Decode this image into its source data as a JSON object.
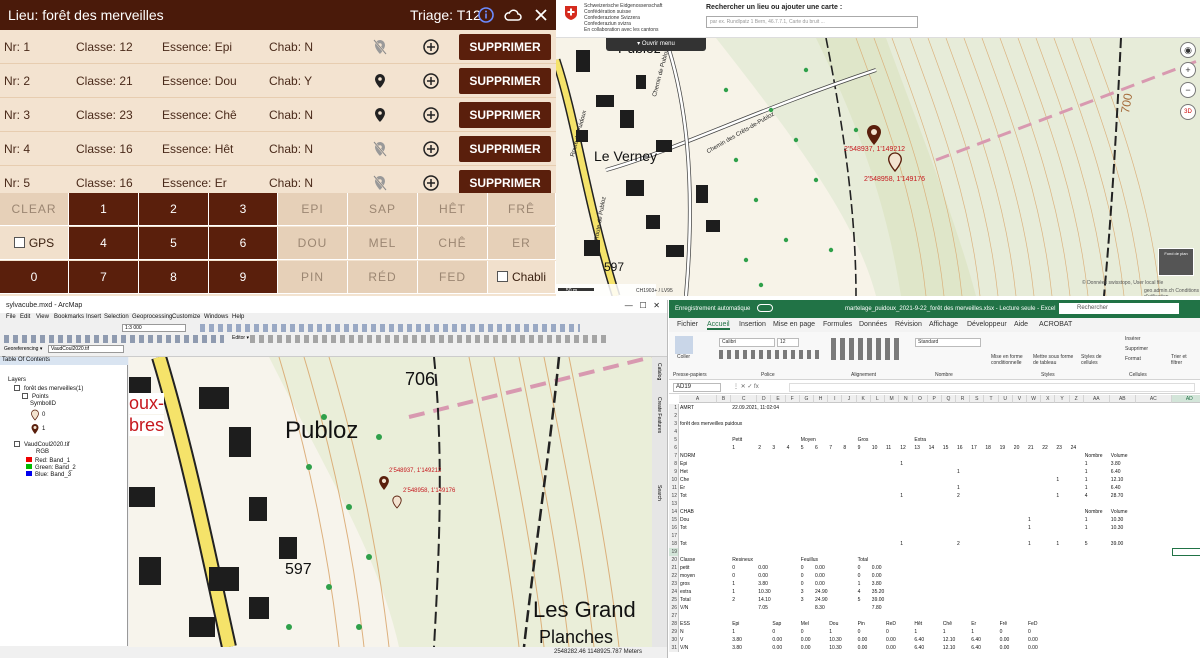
{
  "app": {
    "header": {
      "title": "Lieu: forêt des merveilles",
      "triage": "Triage: T12"
    },
    "rows": [
      {
        "nr": "Nr: 1",
        "classe": "Classe: 12",
        "essence": "Essence: Epi",
        "chab": "Chab: N",
        "pin": "off"
      },
      {
        "nr": "Nr: 2",
        "classe": "Classe: 21",
        "essence": "Essence: Dou",
        "chab": "Chab: Y",
        "pin": "on"
      },
      {
        "nr": "Nr: 3",
        "classe": "Classe: 23",
        "essence": "Essence: Chê",
        "chab": "Chab: N",
        "pin": "on"
      },
      {
        "nr": "Nr: 4",
        "classe": "Classe: 16",
        "essence": "Essence: Hêt",
        "chab": "Chab: N",
        "pin": "off"
      },
      {
        "nr": "Nr: 5",
        "classe": "Classe: 16",
        "essence": "Essence: Er",
        "chab": "Chab: N",
        "pin": "off"
      }
    ],
    "delete_label": "SUPPRIMER",
    "keypad": {
      "clear": "CLEAR",
      "gps": "GPS",
      "zero": "0",
      "chabli": "Chabli",
      "digits": [
        "1",
        "2",
        "3",
        "4",
        "5",
        "6",
        "7",
        "8",
        "9"
      ],
      "species": [
        "EPI",
        "SAP",
        "HÊT",
        "FRÊ",
        "DOU",
        "MEL",
        "CHÊ",
        "ER",
        "PIN",
        "RÉD",
        "FED"
      ]
    }
  },
  "swiss_map": {
    "confed": [
      "Schweizerische Eidgenossenschaft",
      "Confédération suisse",
      "Confederazione Svizzera",
      "Confederaziun svizra",
      "En collaboration avec les cantons"
    ],
    "search_label": "Rechercher un lieu ou ajouter une carte :",
    "search_placeholder": "par ex. Rundlpatz 1 Bern, 46.7.7.1, Carte du bruit ...",
    "open_menu": "Ouvrir menu",
    "place_names": [
      "Le Verney",
      "Publoz",
      "Chemin de Publoz",
      "Chemin des Crêts-de-Publoz",
      "Route de Puidoux",
      "Route de Publoz"
    ],
    "contour": "700",
    "spot_height": "597",
    "marker_labels": [
      "2'548937, 1'149212",
      "2'548958, 1'149176"
    ],
    "scale": "50 m",
    "coord_system": "CH1903+ / LV95",
    "copyright": "© Données swisstopo, User local file",
    "footer": "geo.admin.ch   Conditions d'utilisation",
    "basemap": "Fond de plan"
  },
  "arcmap": {
    "title": "sylvacube.mxd - ArcMap",
    "menu": [
      "File",
      "Edit",
      "View",
      "Bookmarks",
      "Insert",
      "Selection",
      "Geoprocessing",
      "Customize",
      "Windows",
      "Help"
    ],
    "scale": "1:3 000",
    "georef_label": "Georeferencing ▾",
    "georef_layer": "VaudCoul2020.tif",
    "editor": "Editor ▾",
    "toc_title": "Table Of Contents",
    "toc": [
      "Layers",
      "forêt des merveilles(1)",
      "Points",
      "SymbolID",
      "0",
      "1",
      "VaudCoul2020.tif",
      "RGB",
      "Red: Band_1",
      "Green: Band_2",
      "Blue: Band_3"
    ],
    "map_labels": [
      "Publoz",
      "706",
      "597",
      "oux-",
      "bres",
      "Les Grand",
      "Planches"
    ],
    "marker_labels": [
      "2'548937, 1'149212",
      "2'548958, 1'149176"
    ],
    "side_tabs": [
      "Catalog",
      "Create Features",
      "Search"
    ],
    "status": "2548282.46  1148925.787 Meters"
  },
  "excel": {
    "autosave": "Enregistrement automatique",
    "filename": "martelage_puidoux_2021-9-22_forêt des merveilles.xlsx - Lecture seule - Excel",
    "search": "Rechercher",
    "tabs": [
      "Fichier",
      "Accueil",
      "Insertion",
      "Mise en page",
      "Formules",
      "Données",
      "Révision",
      "Affichage",
      "Développeur",
      "Aide",
      "ACROBAT"
    ],
    "ribbon": {
      "paste": "Coller",
      "font": "Calibri",
      "size": "12",
      "format": "Standard",
      "clipboard": "Presse-papiers",
      "police": "Police",
      "alignement": "Alignement",
      "nombre": "Nombre",
      "styles": "Styles",
      "cellules": "Cellules",
      "mef_cond": "Mise en forme conditionnelle",
      "mef_table": "Mettre sous forme de tableau",
      "styles_cell": "Styles de cellules",
      "insert": "Insérer",
      "delete": "Supprimer",
      "format_btn": "Format",
      "sort": "Trier et filtrer"
    },
    "name_box": "AD19",
    "columns": [
      "A",
      "B",
      "C",
      "D",
      "E",
      "F",
      "G",
      "H",
      "I",
      "J",
      "K",
      "L",
      "M",
      "N",
      "O",
      "P",
      "Q",
      "R",
      "S",
      "T",
      "U",
      "V",
      "W",
      "X",
      "Y",
      "Z",
      "AA",
      "AB",
      "AC",
      "AD"
    ],
    "rows": [
      {
        "n": "1",
        "cells": [
          [
            "A",
            "AMRT"
          ],
          [
            "C",
            "22.09.2021, 11:02:04"
          ]
        ]
      },
      {
        "n": "2",
        "cells": []
      },
      {
        "n": "3",
        "cells": [
          [
            "A",
            "forêt des merveilles puidoux"
          ]
        ]
      },
      {
        "n": "4",
        "cells": []
      },
      {
        "n": "5",
        "cells": [
          [
            "C",
            "Petit"
          ],
          [
            "G",
            "Moyen"
          ],
          [
            "K",
            "Gros"
          ],
          [
            "O",
            "Extra"
          ]
        ]
      },
      {
        "n": "6",
        "cells": [
          [
            "C",
            "1"
          ],
          [
            "D",
            "2"
          ],
          [
            "E",
            "3"
          ],
          [
            "F",
            "4"
          ],
          [
            "G",
            "5"
          ],
          [
            "H",
            "6"
          ],
          [
            "I",
            "7"
          ],
          [
            "J",
            "8"
          ],
          [
            "K",
            "9"
          ],
          [
            "L",
            "10"
          ],
          [
            "M",
            "11"
          ],
          [
            "N",
            "12"
          ],
          [
            "O",
            "13"
          ],
          [
            "P",
            "14"
          ],
          [
            "Q",
            "15"
          ],
          [
            "R",
            "16"
          ],
          [
            "S",
            "17"
          ],
          [
            "T",
            "18"
          ],
          [
            "U",
            "19"
          ],
          [
            "V",
            "20"
          ],
          [
            "W",
            "21"
          ],
          [
            "X",
            "22"
          ],
          [
            "Y",
            "23"
          ],
          [
            "Z",
            "24"
          ]
        ]
      },
      {
        "n": "7",
        "cells": [
          [
            "A",
            "NORM"
          ],
          [
            "AA",
            "Nombre"
          ],
          [
            "AB",
            "Volume"
          ]
        ]
      },
      {
        "n": "8",
        "cells": [
          [
            "A",
            "Epi"
          ],
          [
            "N",
            "1"
          ],
          [
            "AA",
            "1"
          ],
          [
            "AB",
            "3.80"
          ]
        ]
      },
      {
        "n": "9",
        "cells": [
          [
            "A",
            "Het"
          ],
          [
            "R",
            "1"
          ],
          [
            "AA",
            "1"
          ],
          [
            "AB",
            "6.40"
          ]
        ]
      },
      {
        "n": "10",
        "cells": [
          [
            "A",
            "Che"
          ],
          [
            "Y",
            "1"
          ],
          [
            "AA",
            "1"
          ],
          [
            "AB",
            "12.10"
          ]
        ]
      },
      {
        "n": "11",
        "cells": [
          [
            "A",
            "Er"
          ],
          [
            "R",
            "1"
          ],
          [
            "AA",
            "1"
          ],
          [
            "AB",
            "6.40"
          ]
        ]
      },
      {
        "n": "12",
        "cells": [
          [
            "A",
            "Tot"
          ],
          [
            "N",
            "1"
          ],
          [
            "R",
            "2"
          ],
          [
            "Y",
            "1"
          ],
          [
            "AA",
            "4"
          ],
          [
            "AB",
            "28.70"
          ]
        ]
      },
      {
        "n": "13",
        "cells": []
      },
      {
        "n": "14",
        "cells": [
          [
            "A",
            "CHAB"
          ],
          [
            "AA",
            "Nombre"
          ],
          [
            "AB",
            "Volume"
          ]
        ]
      },
      {
        "n": "15",
        "cells": [
          [
            "A",
            "Dou"
          ],
          [
            "W",
            "1"
          ],
          [
            "AA",
            "1"
          ],
          [
            "AB",
            "10.30"
          ]
        ]
      },
      {
        "n": "16",
        "cells": [
          [
            "A",
            "Tot"
          ],
          [
            "W",
            "1"
          ],
          [
            "AA",
            "1"
          ],
          [
            "AB",
            "10.30"
          ]
        ]
      },
      {
        "n": "17",
        "cells": []
      },
      {
        "n": "18",
        "cells": [
          [
            "A",
            "Tot"
          ],
          [
            "N",
            "1"
          ],
          [
            "R",
            "2"
          ],
          [
            "W",
            "1"
          ],
          [
            "Y",
            "1"
          ],
          [
            "AA",
            "5"
          ],
          [
            "AB",
            "39.00"
          ]
        ]
      },
      {
        "n": "19",
        "cells": []
      },
      {
        "n": "20",
        "cells": [
          [
            "A",
            "Classe"
          ],
          [
            "C",
            "Resineux"
          ],
          [
            "G",
            "Feuillus"
          ],
          [
            "K",
            "Total"
          ]
        ]
      },
      {
        "n": "21",
        "cells": [
          [
            "A",
            "petit"
          ],
          [
            "C",
            "0"
          ],
          [
            "D",
            "0.00"
          ],
          [
            "G",
            "0"
          ],
          [
            "H",
            "0.00"
          ],
          [
            "K",
            "0"
          ],
          [
            "L",
            "0.00"
          ]
        ]
      },
      {
        "n": "22",
        "cells": [
          [
            "A",
            "moyen"
          ],
          [
            "C",
            "0"
          ],
          [
            "D",
            "0.00"
          ],
          [
            "G",
            "0"
          ],
          [
            "H",
            "0.00"
          ],
          [
            "K",
            "0"
          ],
          [
            "L",
            "0.00"
          ]
        ]
      },
      {
        "n": "23",
        "cells": [
          [
            "A",
            "gros"
          ],
          [
            "C",
            "1"
          ],
          [
            "D",
            "3.80"
          ],
          [
            "G",
            "0"
          ],
          [
            "H",
            "0.00"
          ],
          [
            "K",
            "1"
          ],
          [
            "L",
            "3.80"
          ]
        ]
      },
      {
        "n": "24",
        "cells": [
          [
            "A",
            "extra"
          ],
          [
            "C",
            "1"
          ],
          [
            "D",
            "10.30"
          ],
          [
            "G",
            "3"
          ],
          [
            "H",
            "24.90"
          ],
          [
            "K",
            "4"
          ],
          [
            "L",
            "35.20"
          ]
        ]
      },
      {
        "n": "25",
        "cells": [
          [
            "A",
            "Total"
          ],
          [
            "C",
            "2"
          ],
          [
            "D",
            "14.10"
          ],
          [
            "G",
            "3"
          ],
          [
            "H",
            "24.90"
          ],
          [
            "K",
            "5"
          ],
          [
            "L",
            "39.00"
          ]
        ]
      },
      {
        "n": "26",
        "cells": [
          [
            "A",
            "V/N"
          ],
          [
            "D",
            "7.05"
          ],
          [
            "H",
            "8.30"
          ],
          [
            "L",
            "7.80"
          ]
        ]
      },
      {
        "n": "27",
        "cells": []
      },
      {
        "n": "28",
        "cells": [
          [
            "A",
            "ESS"
          ],
          [
            "C",
            "Epi"
          ],
          [
            "E",
            "Sap"
          ],
          [
            "G",
            "Mel"
          ],
          [
            "I",
            "Dou"
          ],
          [
            "K",
            "Pin"
          ],
          [
            "M",
            "ReD"
          ],
          [
            "O",
            "Hêt"
          ],
          [
            "Q",
            "Chê"
          ],
          [
            "S",
            "Er"
          ],
          [
            "U",
            "Frê"
          ],
          [
            "W",
            "FeD"
          ]
        ]
      },
      {
        "n": "29",
        "cells": [
          [
            "A",
            "N"
          ],
          [
            "C",
            "1"
          ],
          [
            "E",
            "0"
          ],
          [
            "G",
            "0"
          ],
          [
            "I",
            "1"
          ],
          [
            "K",
            "0"
          ],
          [
            "M",
            "0"
          ],
          [
            "O",
            "1"
          ],
          [
            "Q",
            "1"
          ],
          [
            "S",
            "1"
          ],
          [
            "U",
            "0"
          ],
          [
            "W",
            "0"
          ]
        ]
      },
      {
        "n": "30",
        "cells": [
          [
            "A",
            "V"
          ],
          [
            "C",
            "3.80"
          ],
          [
            "E",
            "0.00"
          ],
          [
            "G",
            "0.00"
          ],
          [
            "I",
            "10.30"
          ],
          [
            "K",
            "0.00"
          ],
          [
            "M",
            "0.00"
          ],
          [
            "O",
            "6.40"
          ],
          [
            "Q",
            "12.10"
          ],
          [
            "S",
            "6.40"
          ],
          [
            "U",
            "0.00"
          ],
          [
            "W",
            "0.00"
          ]
        ]
      },
      {
        "n": "31",
        "cells": [
          [
            "A",
            "V/N"
          ],
          [
            "C",
            "3.80"
          ],
          [
            "E",
            "0.00"
          ],
          [
            "G",
            "0.00"
          ],
          [
            "I",
            "10.30"
          ],
          [
            "K",
            "0.00"
          ],
          [
            "M",
            "0.00"
          ],
          [
            "O",
            "6.40"
          ],
          [
            "Q",
            "12.10"
          ],
          [
            "S",
            "6.40"
          ],
          [
            "U",
            "0.00"
          ],
          [
            "W",
            "0.00"
          ]
        ]
      }
    ]
  }
}
